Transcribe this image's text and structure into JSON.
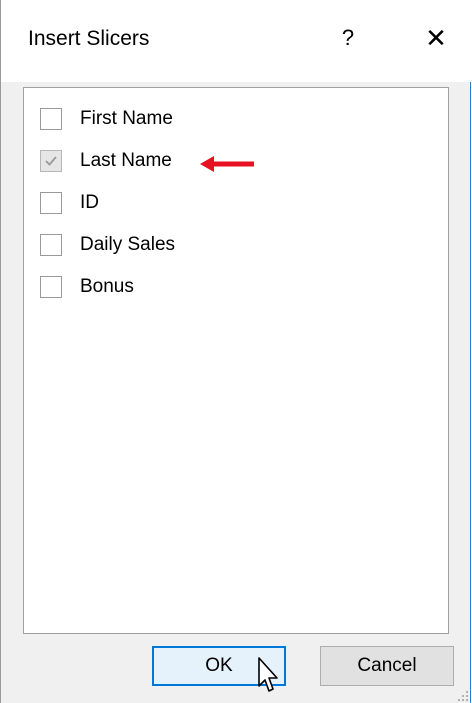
{
  "dialog": {
    "title": "Insert Slicers",
    "help_label": "?",
    "close_label": "✕"
  },
  "fields": [
    {
      "label": "First Name",
      "checked": false
    },
    {
      "label": "Last Name",
      "checked": true
    },
    {
      "label": "ID",
      "checked": false
    },
    {
      "label": "Daily Sales",
      "checked": false
    },
    {
      "label": "Bonus",
      "checked": false
    }
  ],
  "buttons": {
    "ok_label": "OK",
    "cancel_label": "Cancel"
  },
  "colors": {
    "annotation_arrow": "#e81123",
    "focus_border": "#0078d7"
  }
}
